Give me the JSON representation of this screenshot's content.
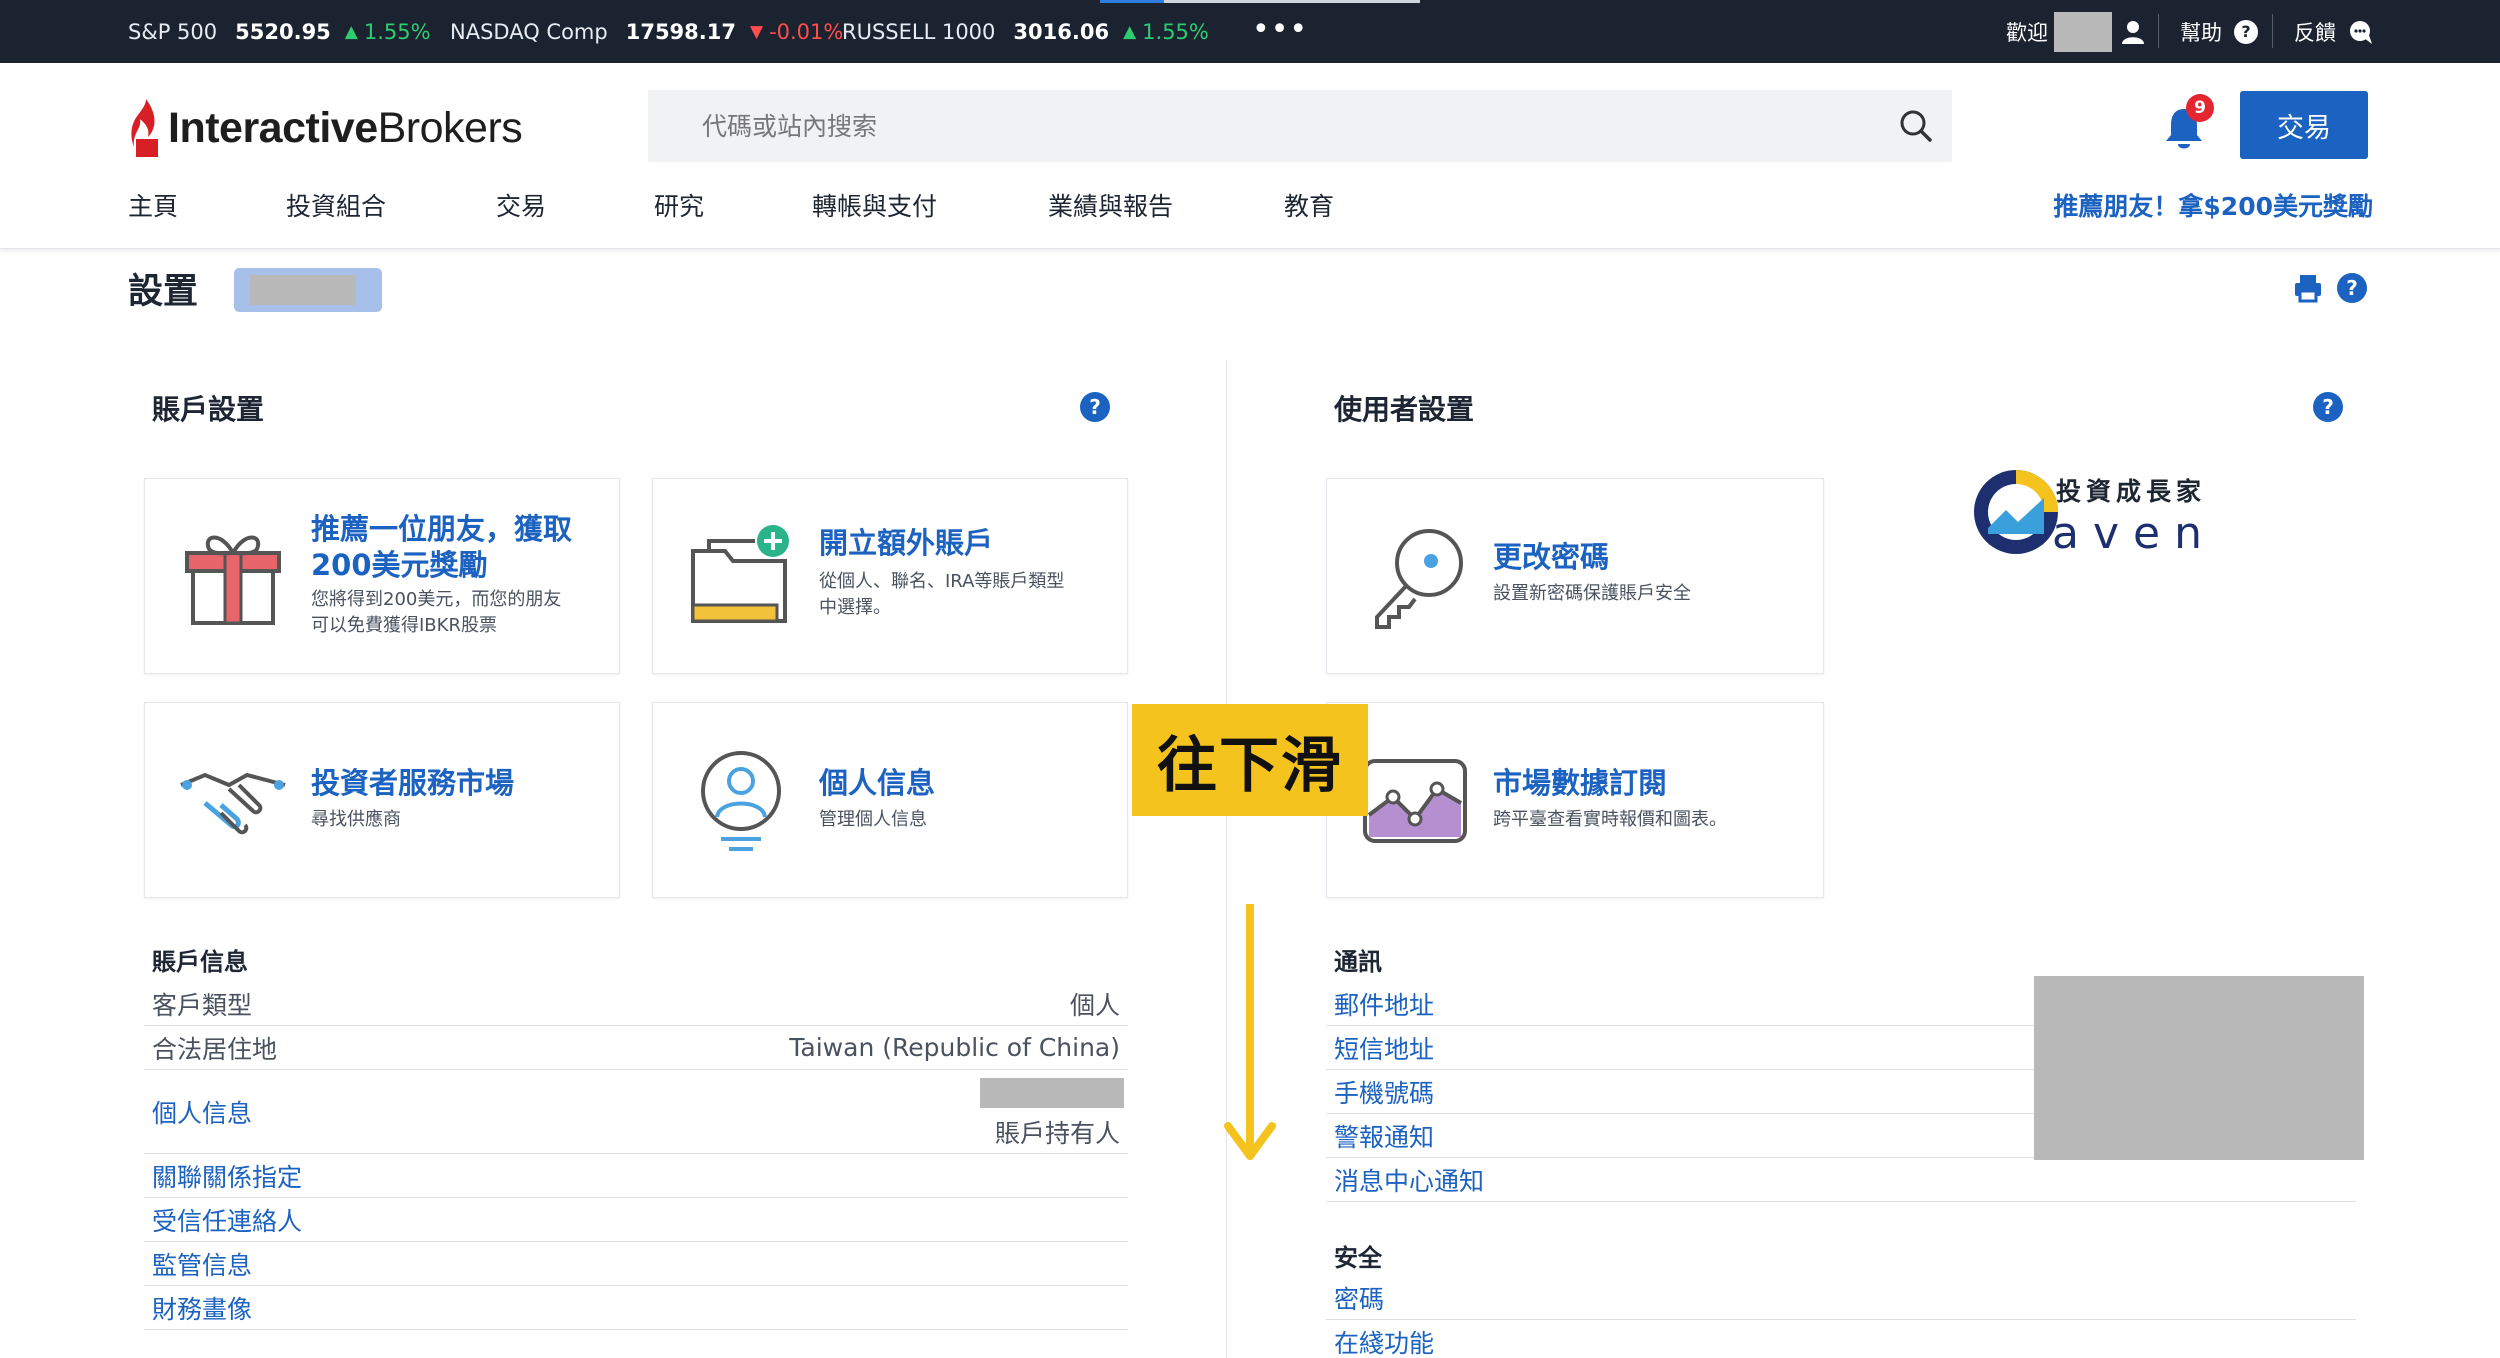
{
  "ticker": {
    "items": [
      {
        "name": "S&P 500",
        "value": "5520.95",
        "arrow": "▲",
        "change": "1.55%",
        "direction": "up"
      },
      {
        "name": "NASDAQ Comp",
        "value": "17598.17",
        "arrow": "▼",
        "change": "-0.01%",
        "direction": "down"
      },
      {
        "name": "RUSSELL 1000",
        "value": "3016.06",
        "arrow": "▲",
        "change": "1.55%",
        "direction": "up"
      }
    ],
    "more": "•••",
    "welcome": "歡迎",
    "help": "幫助",
    "feedback": "反饋"
  },
  "header": {
    "logo_bold": "Interactive",
    "logo_light": "Brokers",
    "search_placeholder": "代碼或站內搜索",
    "notification_count": "9",
    "trade_button": "交易",
    "nav": [
      "主頁",
      "投資組合",
      "交易",
      "研究",
      "轉帳與支付",
      "業績與報告",
      "教育"
    ],
    "promo": "推薦朋友！拿$200美元獎勵"
  },
  "page": {
    "title": "設置",
    "help_glyph": "?"
  },
  "account_settings": {
    "title": "賬戶設置",
    "tiles": [
      {
        "title_line1": "推薦一位朋友，獲取",
        "title_line2": "200美元獎勵",
        "desc_line1": "您將得到200美元，而您的朋友",
        "desc_line2": "可以免費獲得IBKR股票",
        "icon": "gift-icon"
      },
      {
        "title_line1": "開立額外賬戶",
        "desc_line1": "從個人、聯名、IRA等賬戶類型",
        "desc_line2": "中選擇。",
        "icon": "folder-add-icon"
      },
      {
        "title_line1": "投資者服務市場",
        "desc_line1": "尋找供應商",
        "icon": "handshake-icon"
      },
      {
        "title_line1": "個人信息",
        "desc_line1": "管理個人信息",
        "icon": "person-icon"
      }
    ]
  },
  "account_info": {
    "title": "賬戶信息",
    "rows": [
      {
        "label": "客戶類型",
        "value": "個人"
      },
      {
        "label": "合法居住地",
        "value": "Taiwan (Republic of China)"
      },
      {
        "label": "個人信息",
        "value": "賬戶持有人"
      },
      {
        "label": "關聯關係指定",
        "value": ""
      },
      {
        "label": "受信任連絡人",
        "value": ""
      },
      {
        "label": "監管信息",
        "value": ""
      },
      {
        "label": "財務畫像",
        "value": ""
      }
    ]
  },
  "user_settings": {
    "title": "使用者設置",
    "tiles": [
      {
        "title_line1": "更改密碼",
        "desc_line1": "設置新密碼保護賬戶安全",
        "icon": "key-icon"
      },
      {
        "title_line1": "市場數據訂閱",
        "desc_line1": "跨平臺查看實時報價和圖表。",
        "icon": "chart-icon"
      }
    ]
  },
  "communication": {
    "title": "通訊",
    "items": [
      "郵件地址",
      "短信地址",
      "手機號碼",
      "警報通知",
      "消息中心通知"
    ]
  },
  "security": {
    "title": "安全",
    "items": [
      "密碼",
      "在綫功能"
    ]
  },
  "overlay": {
    "scroll_label": "往下滑",
    "watermark_line1": "投資成長家",
    "watermark_line2": "aven"
  },
  "colors": {
    "accent": "#1c62c1",
    "ticker_bg": "#1b2330",
    "up": "#2ecc71",
    "down": "#ff4d4f",
    "overlay_yellow": "#f5c31d"
  }
}
